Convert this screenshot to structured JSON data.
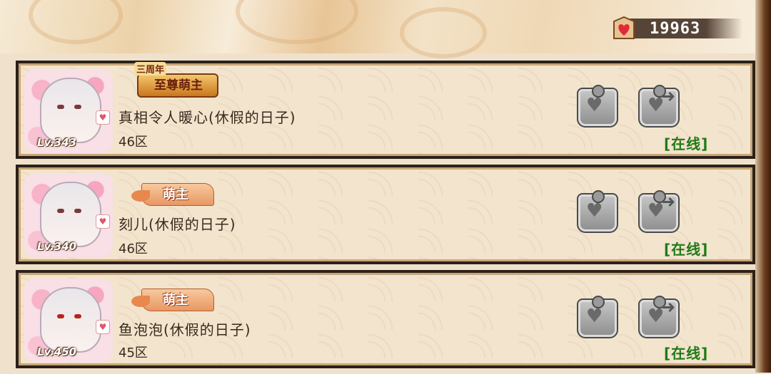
{
  "currency": {
    "icon": "heart-tag-icon",
    "amount": "19963"
  },
  "friends": [
    {
      "badge": {
        "type": "anniversary",
        "line1": "三周年",
        "line2": "至尊萌主"
      },
      "level": "Lv.343",
      "name": "真相令人暖心(休假的日子)",
      "server": "46区",
      "status": "[在线]"
    },
    {
      "badge": {
        "type": "meng",
        "text": "萌主"
      },
      "level": "Lv.340",
      "name": "刻儿(休假的日子)",
      "server": "46区",
      "status": "[在线]"
    },
    {
      "badge": {
        "type": "meng",
        "text": "萌主"
      },
      "level": "Lv.450",
      "name": "鱼泡泡(休假的日子)",
      "server": "45区",
      "status": "[在线]"
    }
  ],
  "colors": {
    "online": "#1f7a18",
    "card_border": "#2b2119",
    "bg": "#efe1cb"
  }
}
